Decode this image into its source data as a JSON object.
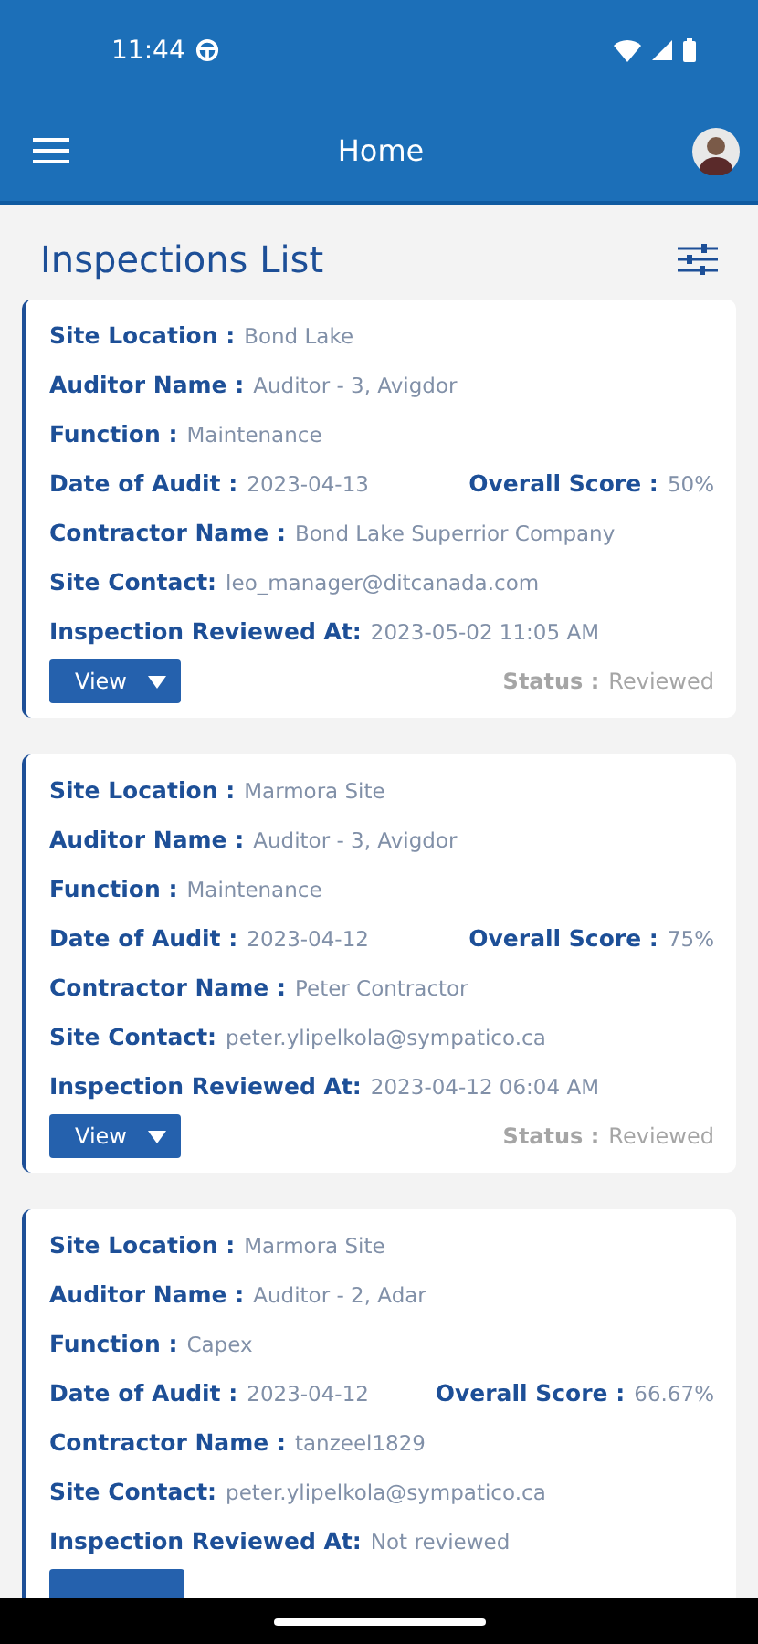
{
  "status_bar": {
    "time": "11:44"
  },
  "app_bar": {
    "title": "Home"
  },
  "heading": "Inspections List",
  "cards": [
    {
      "kind": "full",
      "fields": [
        {
          "label": "Site Location :",
          "value": "Bond Lake"
        },
        {
          "label": "Auditor Name :",
          "value": "Auditor - 3, Avigdor"
        },
        {
          "label": "Function :",
          "value": "Maintenance"
        },
        {
          "label": "Date of Audit :",
          "value": "2023-04-13",
          "right_label": "Overall Score :",
          "right_value": "50%"
        },
        {
          "label": "Contractor Name :",
          "value": "Bond Lake Superrior Company"
        },
        {
          "label": "Site Contact:",
          "value": "leo_manager@ditcanada.com"
        },
        {
          "label": "Inspection Reviewed At:",
          "value": "2023-05-02 11:05 AM"
        }
      ],
      "button": "View",
      "status_label": "Status :",
      "status": "Reviewed"
    },
    {
      "kind": "full",
      "fields": [
        {
          "label": "Site Location :",
          "value": "Marmora Site"
        },
        {
          "label": "Auditor Name :",
          "value": "Auditor - 3, Avigdor"
        },
        {
          "label": "Function :",
          "value": "Maintenance"
        },
        {
          "label": "Date of Audit :",
          "value": "2023-04-12",
          "right_label": "Overall Score :",
          "right_value": "75%"
        },
        {
          "label": "Contractor Name :",
          "value": "Peter Contractor"
        },
        {
          "label": "Site Contact:",
          "value": "peter.ylipelkola@sympatico.ca"
        },
        {
          "label": "Inspection Reviewed At:",
          "value": "2023-04-12 06:04 AM"
        }
      ],
      "button": "View",
      "status_label": "Status :",
      "status": "Reviewed"
    },
    {
      "kind": "cut",
      "fields": [
        {
          "label": "Site Location :",
          "value": "Marmora Site"
        },
        {
          "label": "Auditor Name :",
          "value": "Auditor - 2, Adar"
        },
        {
          "label": "Function :",
          "value": "Capex"
        },
        {
          "label": "Date of Audit :",
          "value": "2023-04-12",
          "right_label": "Overall Score :",
          "right_value": "66.67%"
        },
        {
          "label": "Contractor Name :",
          "value": "tanzeel1829"
        },
        {
          "label": "Site Contact:",
          "value": "peter.ylipelkola@sympatico.ca"
        },
        {
          "label": "Inspection Reviewed At:",
          "value": "Not reviewed"
        }
      ]
    }
  ]
}
